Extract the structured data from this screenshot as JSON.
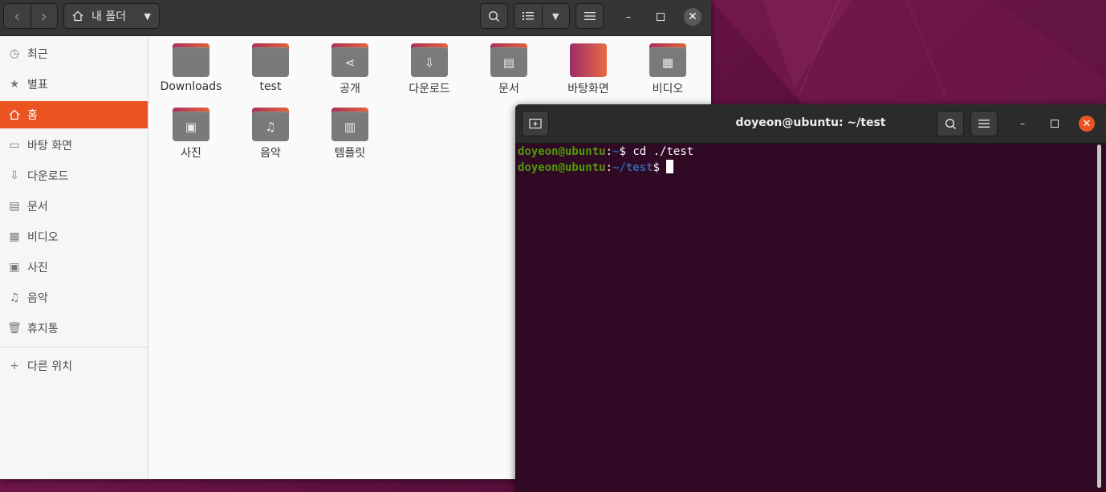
{
  "files_window": {
    "path": "내 폴더",
    "sidebar": [
      {
        "label": "최근",
        "icon": "clock-icon"
      },
      {
        "label": "별표",
        "icon": "star-icon"
      },
      {
        "label": "홈",
        "icon": "home-icon",
        "active": true
      },
      {
        "label": "바탕 화면",
        "icon": "desktop-icon"
      },
      {
        "label": "다운로드",
        "icon": "download-icon"
      },
      {
        "label": "문서",
        "icon": "document-icon"
      },
      {
        "label": "비디오",
        "icon": "video-icon"
      },
      {
        "label": "사진",
        "icon": "picture-icon"
      },
      {
        "label": "음악",
        "icon": "music-icon"
      },
      {
        "label": "휴지통",
        "icon": "trash-icon"
      }
    ],
    "other_locations": "다른 위치",
    "add_icon": "plus-icon",
    "items": [
      {
        "name": "Downloads",
        "icon": "folder-icon"
      },
      {
        "name": "test",
        "icon": "folder-icon"
      },
      {
        "name": "공개",
        "icon": "share-icon"
      },
      {
        "name": "다운로드",
        "icon": "download-icon"
      },
      {
        "name": "문서",
        "icon": "document-icon"
      },
      {
        "name": "바탕화면",
        "icon": "desktop-folder-icon"
      },
      {
        "name": "비디오",
        "icon": "video-icon"
      },
      {
        "name": "사진",
        "icon": "picture-icon"
      },
      {
        "name": "음악",
        "icon": "music-icon"
      },
      {
        "name": "템플릿",
        "icon": "template-icon"
      }
    ]
  },
  "terminal": {
    "title": "doyeon@ubuntu: ~/test",
    "lines": [
      {
        "user": "doyeon@ubuntu",
        "sep": ":",
        "path": "~",
        "prompt": "$ ",
        "command": "cd ./test"
      },
      {
        "user": "doyeon@ubuntu",
        "sep": ":",
        "path": "~/test",
        "prompt": "$ ",
        "command": ""
      }
    ]
  },
  "colors": {
    "accent": "#e95420",
    "terminal_bg": "#300a24",
    "prompt_user": "#4e9a06",
    "prompt_path": "#3465a4"
  }
}
